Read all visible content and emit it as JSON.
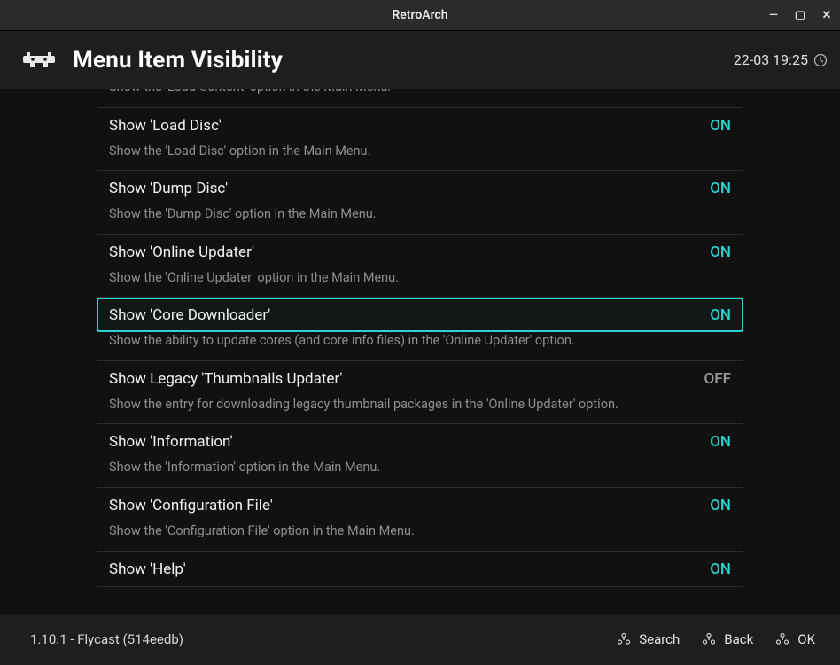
{
  "window": {
    "title": "RetroArch"
  },
  "header": {
    "title": "Menu Item Visibility",
    "clock": "22-03 19:25"
  },
  "settings": [
    {
      "label": "",
      "value": "",
      "state": "",
      "desc": "Show the 'Load Content' option in the Main Menu.",
      "selected": false
    },
    {
      "label": "Show 'Load Disc'",
      "value": "ON",
      "state": "on",
      "desc": "Show the 'Load Disc' option in the Main Menu.",
      "selected": false
    },
    {
      "label": "Show 'Dump Disc'",
      "value": "ON",
      "state": "on",
      "desc": "Show the 'Dump Disc' option in the Main Menu.",
      "selected": false
    },
    {
      "label": "Show 'Online Updater'",
      "value": "ON",
      "state": "on",
      "desc": "Show the 'Online Updater' option in the Main Menu.",
      "selected": false
    },
    {
      "label": "Show 'Core Downloader'",
      "value": "ON",
      "state": "on",
      "desc": "Show the ability to update cores (and core info files) in the 'Online Updater' option.",
      "selected": true
    },
    {
      "label": "Show Legacy 'Thumbnails Updater'",
      "value": "OFF",
      "state": "off",
      "desc": "Show the entry for downloading legacy thumbnail packages in the 'Online Updater' option.",
      "selected": false
    },
    {
      "label": "Show 'Information'",
      "value": "ON",
      "state": "on",
      "desc": "Show the 'Information' option in the Main Menu.",
      "selected": false
    },
    {
      "label": "Show 'Configuration File'",
      "value": "ON",
      "state": "on",
      "desc": "Show the 'Configuration File' option in the Main Menu.",
      "selected": false
    },
    {
      "label": "Show 'Help'",
      "value": "ON",
      "state": "on",
      "desc": "",
      "selected": false
    }
  ],
  "footer": {
    "version": "1.10.1 - Flycast (514eedb)",
    "actions": {
      "search": "Search",
      "back": "Back",
      "ok": "OK"
    }
  },
  "colors": {
    "accent": "#2bd4cf"
  }
}
